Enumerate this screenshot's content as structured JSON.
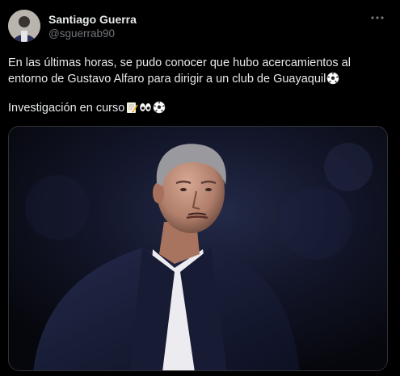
{
  "author": {
    "name": "Santiago Guerra",
    "handle": "@sguerrab90",
    "avatar": "avatar"
  },
  "menu_icon": "more-horizontal-icon",
  "tweet": {
    "line1": "En las últimas horas, se pudo conocer que hubo acercamientos al",
    "line2": "entorno de Gustavo Alfaro para dirigir a un club de Guayaquil",
    "line3": "Investigación en curso",
    "line2_emoji": "soccer-ball-icon",
    "line3_emojis": [
      "memo-icon",
      "eyes-icon",
      "soccer-ball-icon"
    ]
  },
  "media": {
    "type": "photo",
    "subject": "man with gray hair in dark suit and white shirt"
  },
  "colors": {
    "background": "#000000",
    "text": "#e7e9ea",
    "secondary_text": "#71767b",
    "border": "#2f3336"
  }
}
